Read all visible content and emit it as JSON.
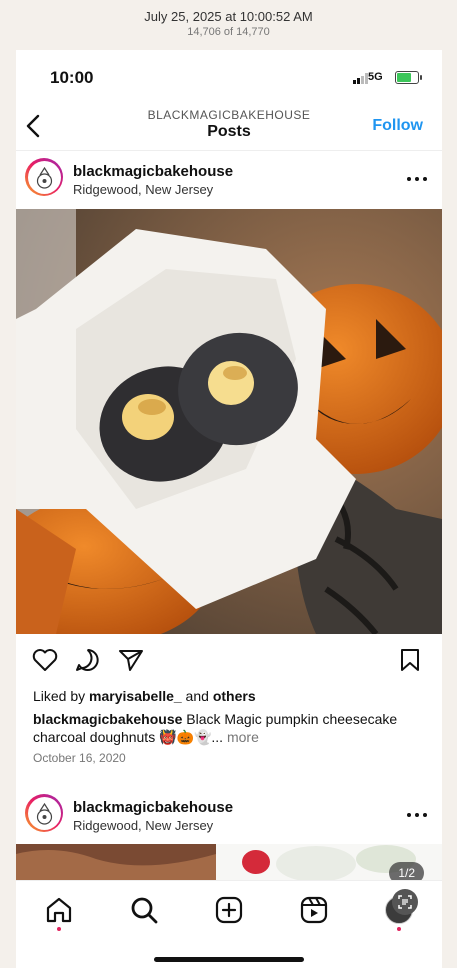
{
  "viewer": {
    "date": "July 25, 2025 at 10:00:52 AM",
    "count": "14,706 of 14,770"
  },
  "status": {
    "time": "10:00",
    "network": "5G"
  },
  "nav": {
    "username": "BLACKMAGICBAKEHOUSE",
    "title": "Posts",
    "follow": "Follow"
  },
  "post1": {
    "username": "blackmagicbakehouse",
    "location": "Ridgewood, New Jersey",
    "liked_by_prefix": "Liked by ",
    "liked_by_user": "maryisabelle_",
    "liked_by_mid": " and ",
    "liked_by_others": "others",
    "caption_user": "blackmagicbakehouse",
    "caption_text": " Black Magic pumpkin cheesecake charcoal doughnuts 👹🎃👻...",
    "more": " more",
    "date": "October 16, 2020"
  },
  "post2": {
    "username": "blackmagicbakehouse",
    "location": "Ridgewood, New Jersey",
    "counter": "1/2"
  },
  "icons": {
    "like": "heart-icon",
    "comment": "comment-icon",
    "share": "send-icon",
    "save": "bookmark-icon"
  },
  "tabs": [
    "home-icon",
    "search-icon",
    "create-icon",
    "reels-icon",
    "profile-avatar"
  ],
  "colors": {
    "follow": "#1f95f0",
    "notification_dot": "#e0245e"
  }
}
